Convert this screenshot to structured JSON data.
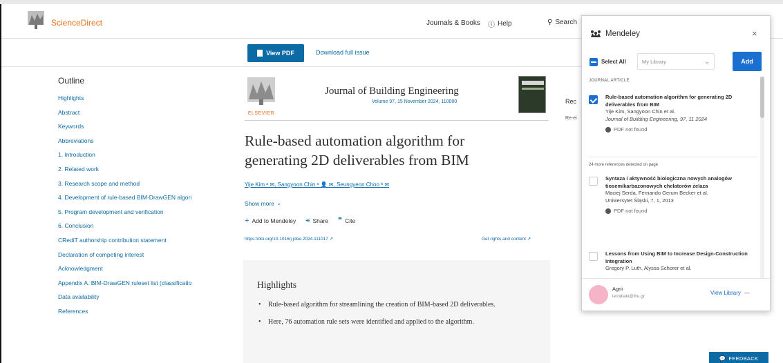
{
  "header": {
    "brand": "ScienceDirect",
    "journals_books": "Journals & Books",
    "help": "Help",
    "search": "Search"
  },
  "toolbar": {
    "view_pdf": "View PDF",
    "download_issue": "Download full issue"
  },
  "outline": {
    "title": "Outline",
    "items": [
      "Highlights",
      "Abstract",
      "Keywords",
      "Abbreviations",
      "1. Introduction",
      "2. Related work",
      "3. Research scope and method",
      "4. Development of rule-based BIM-DrawGEN algori",
      "5. Program development and verification",
      "6. Conclusion",
      "CRediT authorship contribution statement",
      "Declaration of competing interest",
      "Acknowledgment",
      "Appendix A. BIM-DrawGEN ruleset list (classificatio",
      "Data availability",
      "References"
    ]
  },
  "article": {
    "journal_name": "Journal of Building Engineering",
    "volume": "Volume 97, 15 November 2024, 110000",
    "elsevier": "ELSEVIER",
    "title_line1": "Rule-based automation algorithm for",
    "title_line2": "generating 2D deliverables from BIM",
    "authors": "Yije Kim ᵃ ✉, Sangyoon Chin ᵃ 👤 ✉, Seungyeon Choo ᵇ ✉",
    "show_more": "Show more",
    "add_mendeley": "Add to Mendeley",
    "share": "Share",
    "cite": "Cite",
    "doi": "https://doi.org/10.1016/j.jobe.2024.111017 ↗",
    "rights": "Get rights and content ↗"
  },
  "highlights": {
    "title": "Highlights",
    "items": [
      "Rule-based algorithm for streamlining the creation of BIM-based 2D deliverables.",
      "Here, 76 automation rule sets were identified and applied to the algorithm."
    ]
  },
  "recommended": {
    "label": "Rec",
    "sub": "Re-ei"
  },
  "mendeley": {
    "title": "Mendeley",
    "close": "×",
    "select_all": "Select All",
    "library": "My Library",
    "add": "Add",
    "section_journal": "JOURNAL ARTICLE",
    "section_more": "24 more references detected on page",
    "items": [
      {
        "title": "Rule-based automation algorithm for generating 2D deliverables from BIM",
        "authors": "Yije Kim, Sangyoon Chin et al.",
        "journal": "Journal of Building Engineering, 97, 11 2024",
        "pdf": "PDF not found",
        "checked": true
      },
      {
        "title": "Syntaza i aktywność biologiczna nowych analogów tiosemikarbazonowych chelatorów żelaza",
        "authors": "Maciej Serda, Fernando Gerum Becker et al.",
        "journal": "Uniwersytet Śląski, 7, 1, 2013",
        "pdf": "PDF not found",
        "checked": false
      },
      {
        "title": "Lessons from Using BIM to Increase Design-Construction Integration",
        "authors": "Gregory P. Luth, Alyssa Schorer et al.",
        "journal": "",
        "pdf": "",
        "checked": false
      }
    ],
    "user_name": "Agni",
    "user_email": "ierodiaki@ihu.gr",
    "view_library": "View Library"
  },
  "feedback": "FEEDBACK",
  "colors": {
    "brand_orange": "#e9711c",
    "link_blue": "#0c6aa5",
    "mendeley_blue": "#1a6fd0"
  }
}
